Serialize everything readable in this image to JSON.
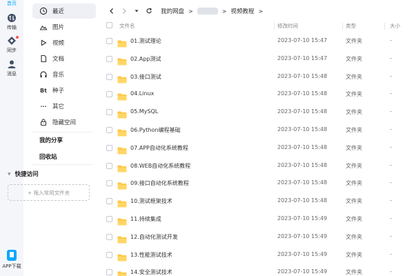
{
  "rail": {
    "items": [
      {
        "label": "首页",
        "icon": "home-icon",
        "active": true
      },
      {
        "label": "传输",
        "icon": "transfer-icon"
      },
      {
        "label": "同步",
        "icon": "sync-icon"
      },
      {
        "label": "消息",
        "icon": "message-icon"
      }
    ],
    "app_download": "APP下载"
  },
  "sidebar": {
    "categories": [
      {
        "label": "最近",
        "icon": "clock-icon",
        "active": true
      },
      {
        "label": "图片",
        "icon": "image-icon"
      },
      {
        "label": "视频",
        "icon": "video-icon"
      },
      {
        "label": "文档",
        "icon": "document-icon"
      },
      {
        "label": "音乐",
        "icon": "headphones-icon"
      },
      {
        "label": "种子",
        "icon": "torrent-icon",
        "glyph": "Bt"
      },
      {
        "label": "其它",
        "icon": "more-icon",
        "glyph": "···"
      },
      {
        "label": "隐藏空间",
        "icon": "lock-icon"
      }
    ],
    "my_share": "我的分享",
    "recycle_bin": "回收站",
    "quick_access": "快捷访问",
    "drop_hint": "+ 拖入常用文件夹"
  },
  "breadcrumb": {
    "root": "我的网盘",
    "current": "视频教程"
  },
  "table": {
    "headers": {
      "name": "文件名",
      "modified": "修改时间",
      "type": "类型",
      "size": "大小"
    },
    "rows": [
      {
        "name": "01.测试理论",
        "modified": "2023-07-10 15:47",
        "type": "文件夹",
        "size": "-"
      },
      {
        "name": "02.App测试",
        "modified": "2023-07-10 15:47",
        "type": "文件夹",
        "size": "-"
      },
      {
        "name": "03.接口测试",
        "modified": "2023-07-10 15:48",
        "type": "文件夹",
        "size": "-"
      },
      {
        "name": "04.Linux",
        "modified": "2023-07-10 15:48",
        "type": "文件夹",
        "size": "-"
      },
      {
        "name": "05.MySQL",
        "modified": "2023-07-10 15:48",
        "type": "文件夹",
        "size": "-"
      },
      {
        "name": "06.Python编程基础",
        "modified": "2023-07-10 15:48",
        "type": "文件夹",
        "size": "-"
      },
      {
        "name": "07.APP自动化系统教程",
        "modified": "2023-07-10 15:48",
        "type": "文件夹",
        "size": "-"
      },
      {
        "name": "08.WEB自动化系统教程",
        "modified": "2023-07-10 15:48",
        "type": "文件夹",
        "size": "-"
      },
      {
        "name": "09.接口自动化系统教程",
        "modified": "2023-07-10 15:48",
        "type": "文件夹",
        "size": "-"
      },
      {
        "name": "10.测试框架技术",
        "modified": "2023-07-10 15:48",
        "type": "文件夹",
        "size": "-"
      },
      {
        "name": "11.持续集成",
        "modified": "2023-07-10 15:49",
        "type": "文件夹",
        "size": "-"
      },
      {
        "name": "12.自动化测试开发",
        "modified": "2023-07-10 15:49",
        "type": "文件夹",
        "size": "-"
      },
      {
        "name": "13.性能测试技术",
        "modified": "2023-07-10 15:49",
        "type": "文件夹",
        "size": "-"
      },
      {
        "name": "14.安全测试技术",
        "modified": "2023-07-10 15:49",
        "type": "文件夹",
        "size": "-"
      }
    ]
  },
  "colors": {
    "accent": "#06a7ff",
    "folder": "#ffc53d",
    "sidebar_active_bg": "#eef0f6"
  }
}
